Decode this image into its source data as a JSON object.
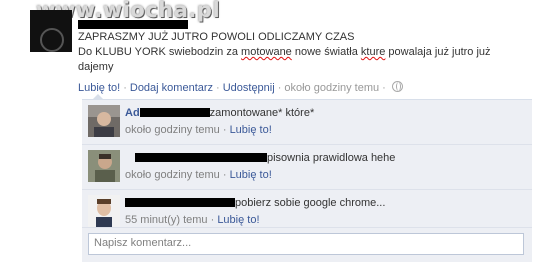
{
  "watermark": {
    "text": "www.wiocha.pl"
  },
  "post": {
    "headline": "ZAPRASZMY JUŻ JUTRO POWOLI ODLICZAMY CZAS",
    "body_before_1": "Do KLUBU YORK swiebodzin za ",
    "body_err_1": "motowane",
    "body_mid": " nowe światła ",
    "body_err_2": "kture",
    "body_after": " powalaja już jutro już dajemy"
  },
  "actions": {
    "like": "Lubię to!",
    "comment": "Dodaj komentarz",
    "share": "Udostępnij",
    "time": "około godziny temu",
    "sep": "·"
  },
  "comments": [
    {
      "name_prefix": "Ad",
      "text": "zamontowane* które*",
      "time": "około godziny temu",
      "like": "Lubię to!"
    },
    {
      "name_prefix": "",
      "text": "pisownia prawidlowa hehe",
      "time": "około godziny temu",
      "like": "Lubię to!"
    },
    {
      "name_prefix": "",
      "text": "pobierz sobie google chrome...",
      "time": "55 minut(y) temu",
      "like": "Lubię to!"
    }
  ],
  "composer": {
    "placeholder": "Napisz komentarz..."
  }
}
